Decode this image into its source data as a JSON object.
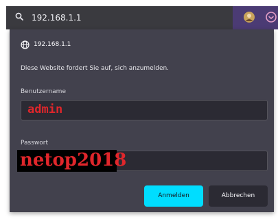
{
  "browser": {
    "url": "192.168.1.1"
  },
  "dialog": {
    "host": "192.168.1.1",
    "prompt": "Diese Website fordert Sie auf, sich anzumelden.",
    "username_label": "Benutzername",
    "username_value": "admin",
    "password_label": "Passwort",
    "password_value": "netop2018",
    "login_label": "Anmelden",
    "cancel_label": "Abbrechen"
  },
  "colors": {
    "topbar": "#4b3b74",
    "dialog_bg": "#42414d",
    "field_bg": "#2b2a33",
    "accent": "#00ddff",
    "annotation_red": "#e0262b"
  }
}
